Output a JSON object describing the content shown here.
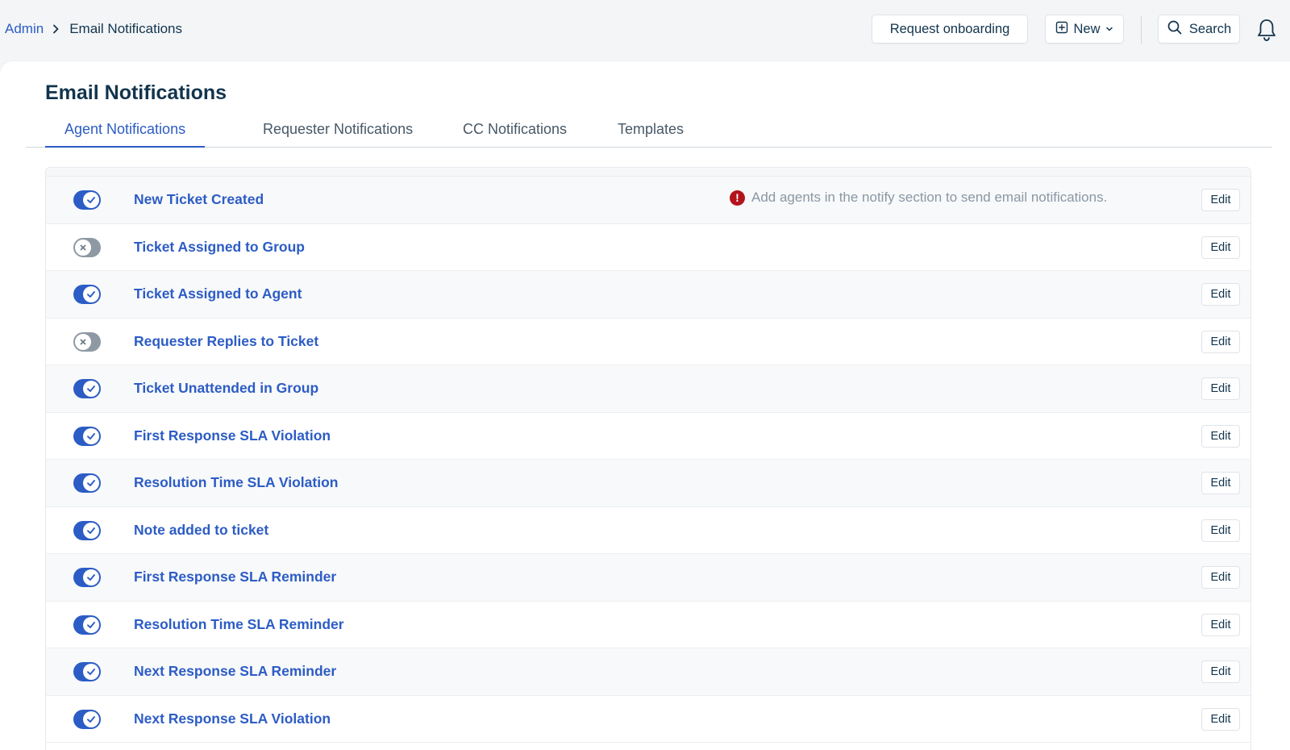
{
  "breadcrumb": {
    "parent": "Admin",
    "current": "Email Notifications"
  },
  "header": {
    "request_onboarding": "Request onboarding",
    "new_label": "New",
    "search_label": "Search"
  },
  "page": {
    "title": "Email Notifications"
  },
  "tabs": [
    {
      "label": "Agent Notifications",
      "active": true
    },
    {
      "label": "Requester Notifications",
      "active": false
    },
    {
      "label": "CC Notifications",
      "active": false
    },
    {
      "label": "Templates",
      "active": false
    }
  ],
  "edit_label": "Edit",
  "colors": {
    "accent": "#2c5cc5",
    "toggle_off": "#8e99a4",
    "warning": "#b3141c",
    "text": "#12344d"
  },
  "notifications": [
    {
      "title": "New Ticket Created",
      "enabled": true,
      "warning": "Add agents in the notify section to send email notifications."
    },
    {
      "title": "Ticket Assigned to Group",
      "enabled": false
    },
    {
      "title": "Ticket Assigned to Agent",
      "enabled": true
    },
    {
      "title": "Requester Replies to Ticket",
      "enabled": false
    },
    {
      "title": "Ticket Unattended in Group",
      "enabled": true
    },
    {
      "title": "First Response SLA Violation",
      "enabled": true
    },
    {
      "title": "Resolution Time SLA Violation",
      "enabled": true
    },
    {
      "title": "Note added to ticket",
      "enabled": true
    },
    {
      "title": "First Response SLA Reminder",
      "enabled": true
    },
    {
      "title": "Resolution Time SLA Reminder",
      "enabled": true
    },
    {
      "title": "Next Response SLA Reminder",
      "enabled": true
    },
    {
      "title": "Next Response SLA Violation",
      "enabled": true
    }
  ]
}
